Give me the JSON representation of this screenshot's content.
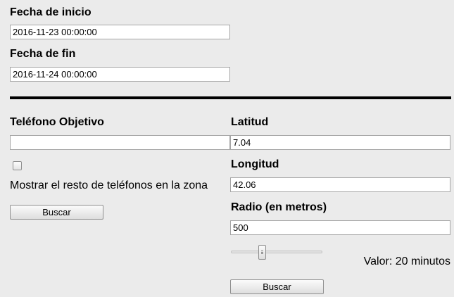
{
  "dates": {
    "start_label": "Fecha de inicio",
    "start_value": "2016-11-23 00:00:00",
    "end_label": "Fecha de fin",
    "end_value": "2016-11-24 00:00:00"
  },
  "phone_search": {
    "target_label": "Teléfono Objetivo",
    "target_value": "",
    "show_rest_checked": false,
    "show_rest_label": "Mostrar el resto de teléfonos en la zona",
    "search_button": "Buscar"
  },
  "zone_search": {
    "lat_label": "Latitud",
    "lat_value": "7.04",
    "lon_label": "Longitud",
    "lon_value": "42.06",
    "radius_label": "Radio (en metros)",
    "radius_value": "500",
    "slider_value_fraction": 0.33,
    "value_text": "Valor: 20 minutos",
    "search_button": "Buscar"
  }
}
